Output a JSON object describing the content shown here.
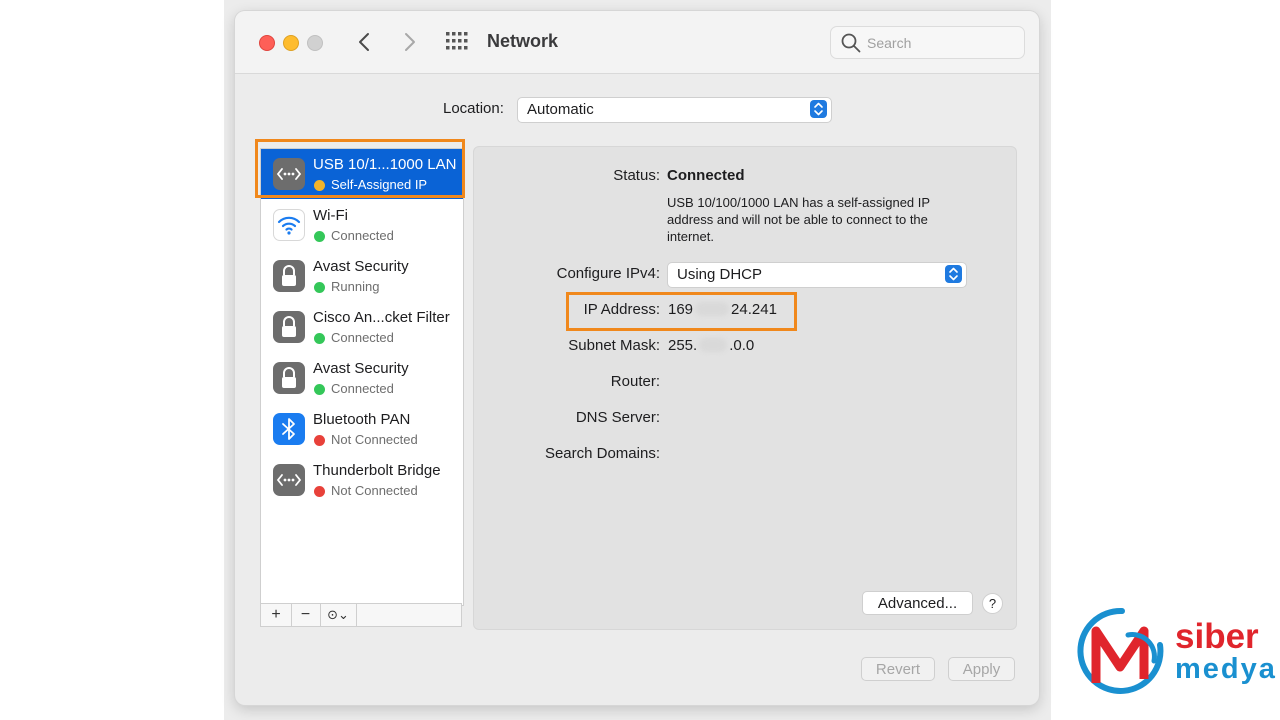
{
  "window": {
    "title": "Network",
    "search_placeholder": "Search"
  },
  "location": {
    "label": "Location:",
    "value": "Automatic"
  },
  "services": [
    {
      "name": "USB 10/1...1000 LAN",
      "status": "Self-Assigned IP",
      "status_color": "#f2b42a",
      "icon": "ethernet-icon",
      "selected": true
    },
    {
      "name": "Wi-Fi",
      "status": "Connected",
      "status_color": "#34c759",
      "icon": "wifi-icon",
      "selected": false
    },
    {
      "name": "Avast Security",
      "status": "Running",
      "status_color": "#34c759",
      "icon": "lock-icon",
      "selected": false
    },
    {
      "name": "Cisco An...cket Filter",
      "status": "Connected",
      "status_color": "#34c759",
      "icon": "lock-icon",
      "selected": false
    },
    {
      "name": "Avast Security",
      "status": "Connected",
      "status_color": "#34c759",
      "icon": "lock-icon",
      "selected": false
    },
    {
      "name": "Bluetooth PAN",
      "status": "Not Connected",
      "status_color": "#e8413a",
      "icon": "bluetooth-icon",
      "selected": false
    },
    {
      "name": "Thunderbolt Bridge",
      "status": "Not Connected",
      "status_color": "#e8413a",
      "icon": "ethernet-icon",
      "selected": false
    }
  ],
  "sidebar_tools": {
    "add": "+",
    "remove": "−",
    "more": "⊙⌄"
  },
  "details": {
    "status_label": "Status:",
    "status_value": "Connected",
    "status_description": "USB 10/100/1000 LAN has a self-assigned IP address and will not be able to connect to the internet.",
    "configure_label": "Configure IPv4:",
    "configure_value": "Using DHCP",
    "ip_label": "IP Address:",
    "ip_prefix": "169",
    "ip_suffix": "24.241",
    "subnet_label": "Subnet Mask:",
    "subnet_prefix": "255.",
    "subnet_suffix": ".0.0",
    "router_label": "Router:",
    "dns_label": "DNS Server:",
    "search_domains_label": "Search Domains:"
  },
  "buttons": {
    "advanced": "Advanced...",
    "help": "?",
    "revert": "Revert",
    "apply": "Apply"
  },
  "watermark": {
    "line1": "siber",
    "line2": "medya"
  },
  "colors": {
    "accent": "#0a63d6",
    "highlight": "#f0881c"
  }
}
